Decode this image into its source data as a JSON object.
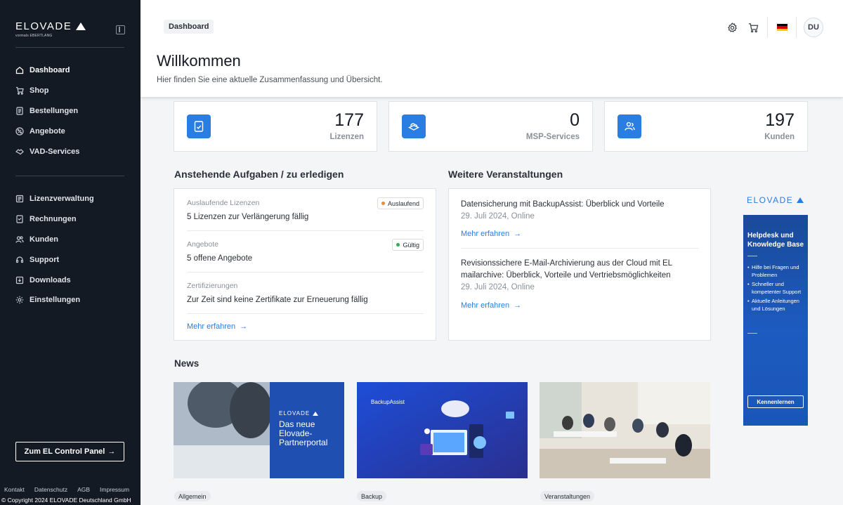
{
  "sidebar": {
    "logo": "ELOVADE",
    "logo_sub": "vormals EBERTLANG",
    "nav_main": [
      {
        "label": "Dashboard",
        "icon": "home-icon",
        "active": true
      },
      {
        "label": "Shop",
        "icon": "cart-icon"
      },
      {
        "label": "Bestellungen",
        "icon": "list-icon"
      },
      {
        "label": "Angebote",
        "icon": "offer-icon"
      },
      {
        "label": "VAD-Services",
        "icon": "handshake-icon"
      }
    ],
    "nav_secondary": [
      {
        "label": "Lizenzverwaltung",
        "icon": "license-icon"
      },
      {
        "label": "Rechnungen",
        "icon": "invoice-icon"
      },
      {
        "label": "Kunden",
        "icon": "users-icon"
      },
      {
        "label": "Support",
        "icon": "support-icon"
      },
      {
        "label": "Downloads",
        "icon": "download-icon"
      },
      {
        "label": "Einstellungen",
        "icon": "gear-icon"
      }
    ],
    "panel_button": "Zum EL Control Panel",
    "footer_links": [
      "Kontakt",
      "Datenschutz",
      "AGB",
      "Impressum"
    ],
    "copyright": "© Copyright 2024 ELOVADE Deutschland GmbH"
  },
  "header": {
    "breadcrumb": "Dashboard",
    "title": "Willkommen",
    "subtitle": "Hier finden Sie eine aktuelle Zusammenfassung und Übersicht.",
    "avatar": "DU"
  },
  "stats": [
    {
      "value": "177",
      "label": "Lizenzen",
      "icon": "license-doc-icon"
    },
    {
      "value": "0",
      "label": "MSP-Services",
      "icon": "msp-cloud-icon"
    },
    {
      "value": "197",
      "label": "Kunden",
      "icon": "customers-icon"
    }
  ],
  "tasks": {
    "title": "Anstehende Aufgaben / zu erledigen",
    "items": [
      {
        "label": "Auslaufende Lizenzen",
        "value": "5 Lizenzen zur Verlängerung fällig",
        "badge": "Auslaufend",
        "badge_color": "#f08a2c"
      },
      {
        "label": "Angebote",
        "value": "5 offene Angebote",
        "badge": "Gültig",
        "badge_color": "#2bb24c"
      },
      {
        "label": "Zertifizierungen",
        "value": "Zur Zeit sind keine Zertifikate zur Erneuerung fällig"
      }
    ],
    "more": "Mehr erfahren"
  },
  "events": {
    "title": "Weitere Veranstaltungen",
    "items": [
      {
        "title": "Datensicherung mit BackupAssist: Überblick und Vorteile",
        "date": "29. Juli 2024, Online",
        "more": "Mehr erfahren"
      },
      {
        "title_line1": "Revisionssichere E-Mail-Archivierung aus der Cloud mit EL",
        "title_line2": "mailarchive: Überblick, Vorteile und Vertriebsmöglichkeiten",
        "date": "29. Juli 2024, Online",
        "more": "Mehr erfahren"
      }
    ]
  },
  "ad": {
    "logo": "ELOVADE",
    "heading_1": "Helpdesk und",
    "heading_2": "Knowledge Base",
    "points": [
      "Hilfe bei Fragen und Problemen",
      "Schneller und kompetenter Support",
      "Aktuelle Anleitungen und Lösungen"
    ],
    "button": "Kennenlernen"
  },
  "news": {
    "title": "News",
    "items": [
      {
        "tag": "Allgemein",
        "logo": "ELOVADE",
        "headline_1": "Das neue",
        "headline_2": "Elovade-",
        "headline_3": "Partnerportal"
      },
      {
        "tag": "Backup",
        "logo_small": "BackupAssist"
      },
      {
        "tag": "Veranstaltungen"
      }
    ]
  },
  "colors": {
    "sidebar_bg": "#141a24",
    "accent": "#2a7de1"
  }
}
